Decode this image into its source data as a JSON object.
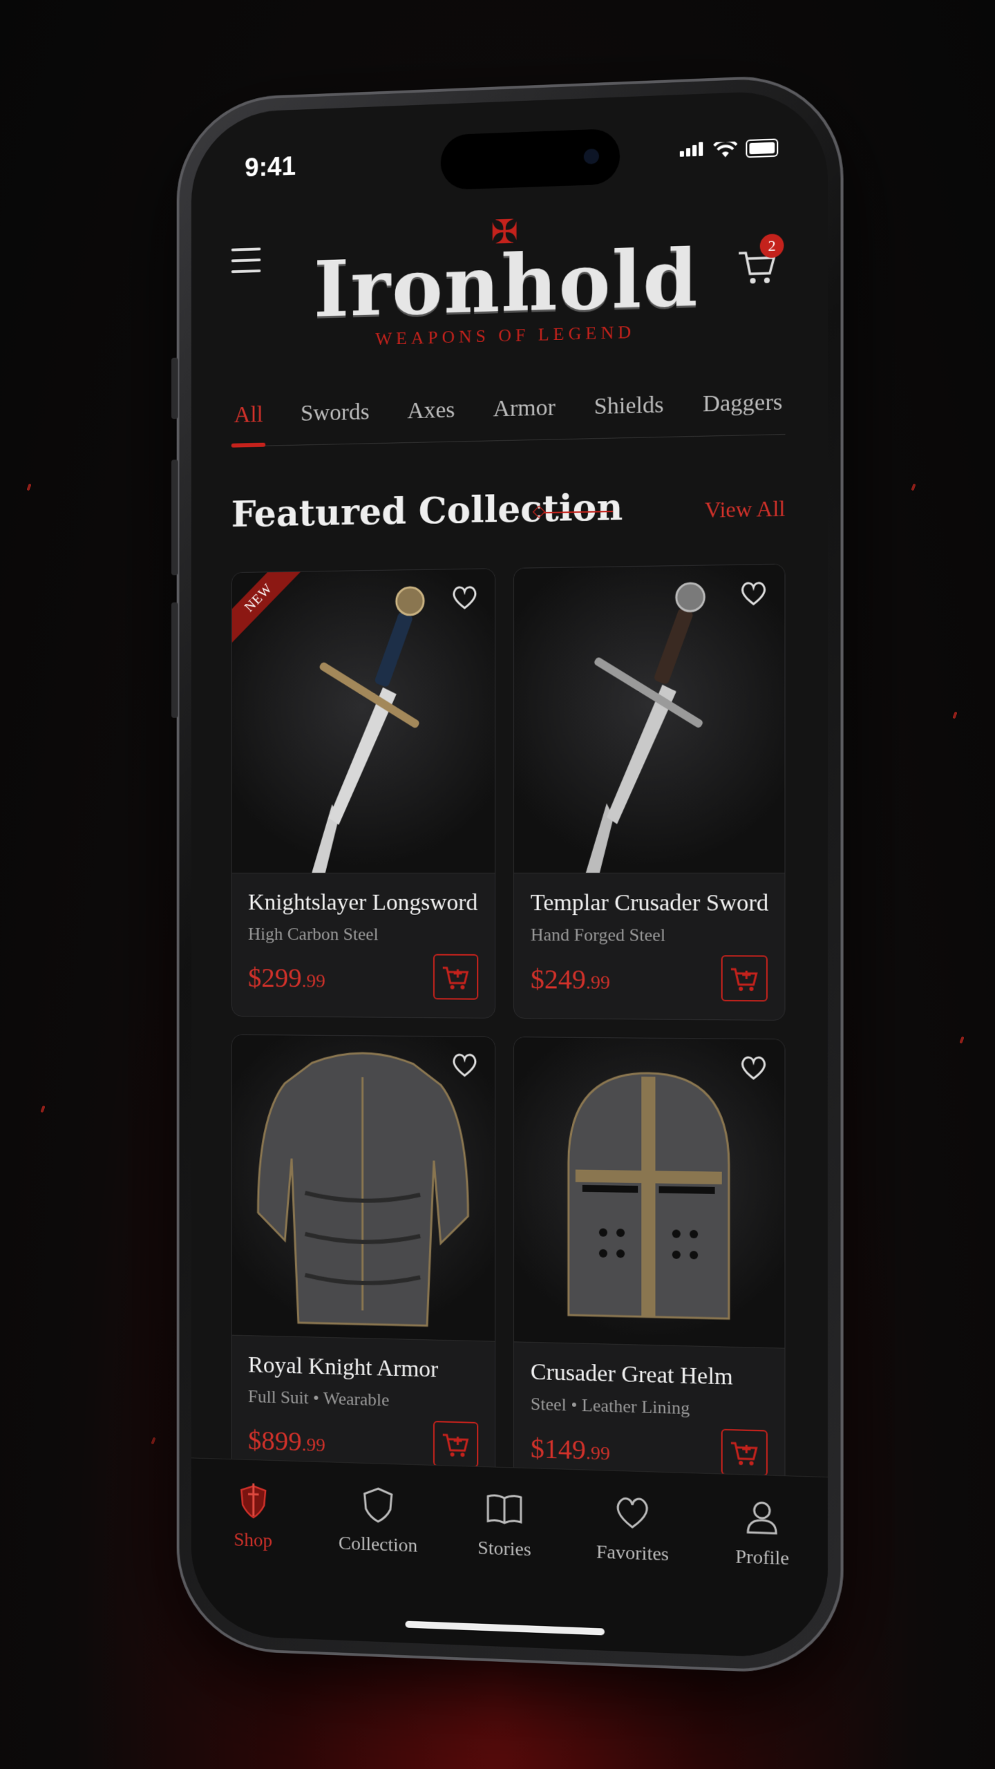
{
  "status_bar": {
    "time": "9:41"
  },
  "header": {
    "brand_name": "Ironhold",
    "brand_tagline": "WEAPONS OF LEGEND",
    "cart_count": "2",
    "menu_icon": "hamburger-icon",
    "cart_icon": "cart-icon"
  },
  "categories": [
    {
      "label": "All",
      "active": true
    },
    {
      "label": "Swords",
      "active": false
    },
    {
      "label": "Axes",
      "active": false
    },
    {
      "label": "Armor",
      "active": false
    },
    {
      "label": "Shields",
      "active": false
    },
    {
      "label": "Daggers",
      "active": false
    }
  ],
  "section": {
    "title": "Featured Collection",
    "view_all": "View All"
  },
  "products": [
    {
      "name": "Knightslayer Longsword",
      "meta": "High Carbon Steel",
      "price_main": "$299",
      "price_cents": ".99",
      "badge": "NEW",
      "image": "longsword-image"
    },
    {
      "name": "Templar Crusader Sword",
      "meta": "Hand Forged Steel",
      "price_main": "$249",
      "price_cents": ".99",
      "badge": "",
      "image": "crusader-sword-image"
    },
    {
      "name": "Royal Knight Armor",
      "meta": "Full Suit • Wearable",
      "price_main": "$899",
      "price_cents": ".99",
      "badge": "",
      "image": "plate-armor-image"
    },
    {
      "name": "Crusader Great Helm",
      "meta": "Steel • Leather Lining",
      "price_main": "$149",
      "price_cents": ".99",
      "badge": "",
      "image": "great-helm-image"
    }
  ],
  "bottom_nav": [
    {
      "label": "Shop",
      "icon": "sword-shield-icon",
      "active": true
    },
    {
      "label": "Collection",
      "icon": "shield-icon",
      "active": false
    },
    {
      "label": "Stories",
      "icon": "book-icon",
      "active": false
    },
    {
      "label": "Favorites",
      "icon": "heart-icon",
      "active": false
    },
    {
      "label": "Profile",
      "icon": "user-icon",
      "active": false
    }
  ],
  "colors": {
    "accent": "#c4221c",
    "background": "#141414",
    "card": "#1b1b1c"
  }
}
